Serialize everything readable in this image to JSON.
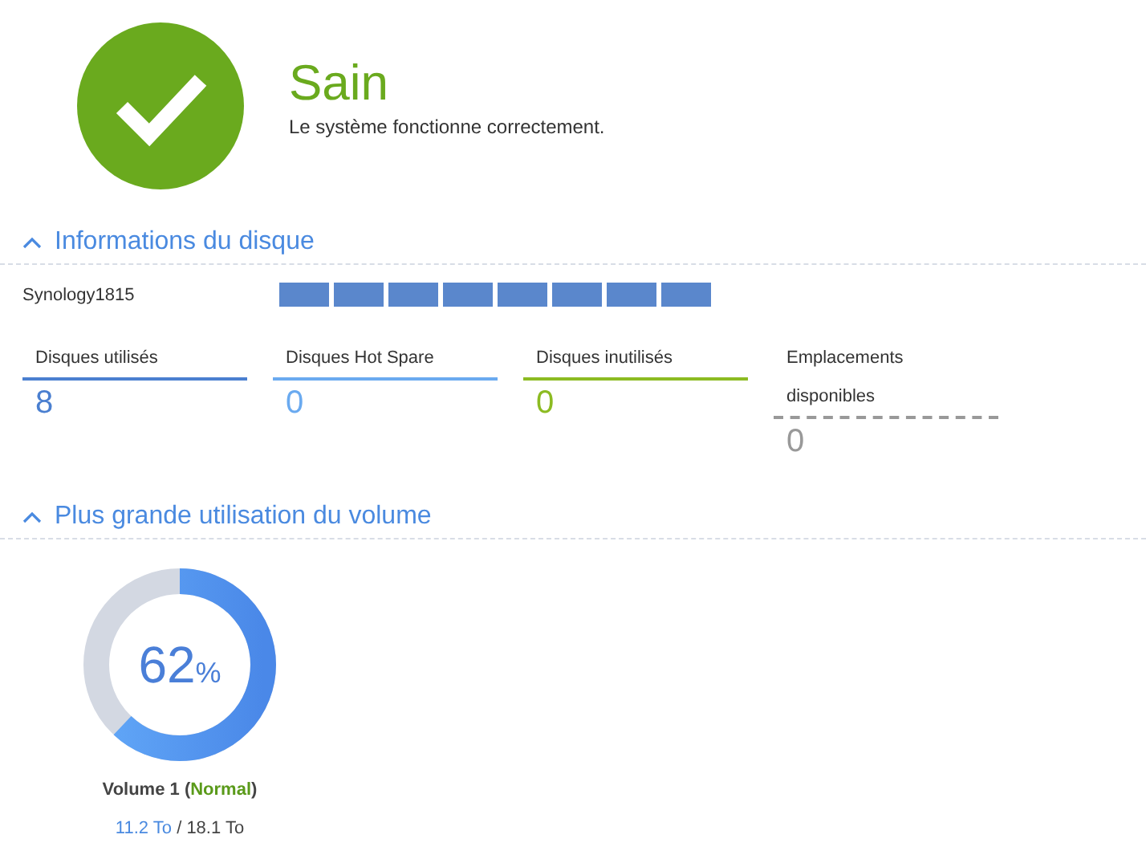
{
  "health": {
    "title": "Sain",
    "message": "Le système fonctionne correctement.",
    "kind": "healthy"
  },
  "disk_section": {
    "title": "Informations du disque",
    "expanded": true,
    "device": "Synology1815",
    "disk_slots": [
      {
        "kind": "used"
      },
      {
        "kind": "used"
      },
      {
        "kind": "used"
      },
      {
        "kind": "used"
      },
      {
        "kind": "used"
      },
      {
        "kind": "used"
      },
      {
        "kind": "used"
      },
      {
        "kind": "used"
      }
    ],
    "stats": [
      {
        "label": "Disques utilisés",
        "value": "8",
        "color": "#4a7fd0",
        "kind": "solid"
      },
      {
        "label": "Disques Hot Spare",
        "value": "0",
        "color": "#6aaaf0",
        "kind": "solid"
      },
      {
        "label": "Disques inutilisés",
        "value": "0",
        "color": "#8cbb22",
        "kind": "solid"
      },
      {
        "label": "Emplacements disponibles",
        "value": "0",
        "color": "#999999",
        "kind": "dashed"
      }
    ]
  },
  "volume_section": {
    "title": "Plus grande utilisation du volume",
    "expanded": true,
    "volume": {
      "percent": "62",
      "unit": "%",
      "title_parts": [
        {
          "text": "Volume 1 ("
        },
        {
          "text": "Normal",
          "kind": "status"
        },
        {
          "text": ")"
        }
      ],
      "used": "11.2 To",
      "separator": "/",
      "total": "18.1 To"
    }
  }
}
